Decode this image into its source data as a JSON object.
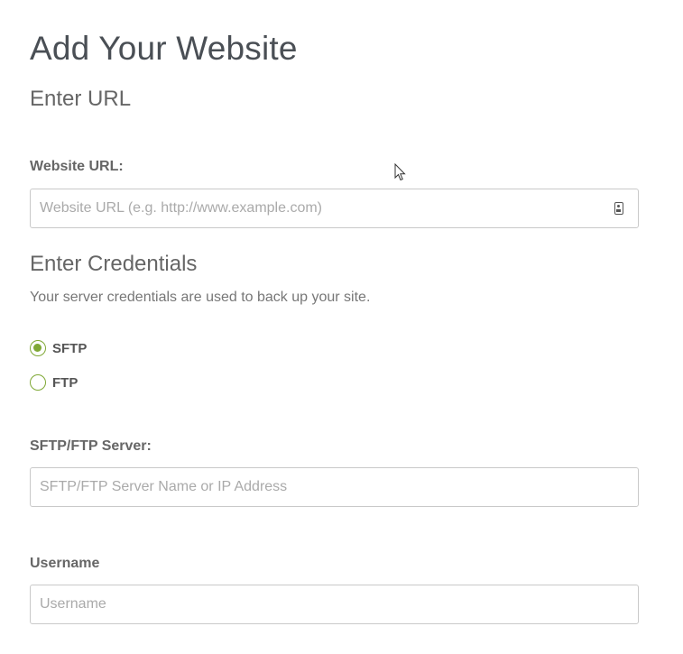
{
  "page": {
    "title": "Add Your Website"
  },
  "url_section": {
    "heading": "Enter URL",
    "website_url_label": "Website URL:",
    "website_url_placeholder": "Website URL (e.g. http://www.example.com)",
    "website_url_value": "",
    "field_icon": "contact-card-icon"
  },
  "credentials_section": {
    "heading": "Enter Credentials",
    "help_text": "Your server credentials are used to back up your site.",
    "protocol_options": [
      {
        "label": "SFTP",
        "checked": true
      },
      {
        "label": "FTP",
        "checked": false
      }
    ],
    "server_label": "SFTP/FTP Server:",
    "server_placeholder": "SFTP/FTP Server Name or IP Address",
    "server_value": "",
    "username_label": "Username",
    "username_placeholder": "Username",
    "username_value": ""
  },
  "colors": {
    "accent": "#7fa835",
    "border": "#c9c9c9",
    "title": "#4a4f55"
  }
}
